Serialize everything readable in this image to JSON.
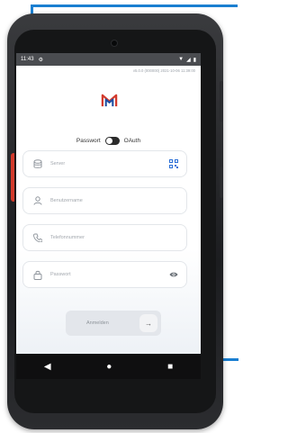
{
  "status_bar": {
    "time": "11:43",
    "signal_icon": "wifi-icon",
    "battery_icon": "battery-icon"
  },
  "version_text": "v5.0.0 (000000) 2021-10-06 11:39:00",
  "auth_toggle": {
    "left_label": "Passwort",
    "right_label": "OAuth"
  },
  "fields": {
    "server": {
      "placeholder": "Server",
      "icon": "database-icon",
      "trailing_icon": "qr-code-icon"
    },
    "username": {
      "placeholder": "Benutzername",
      "icon": "user-icon"
    },
    "phone": {
      "placeholder": "Telefonnummer",
      "icon": "phone-icon"
    },
    "password": {
      "placeholder": "Passwort",
      "icon": "lock-icon",
      "trailing_icon": "eye-icon"
    }
  },
  "login_button": {
    "label": "Anmelden",
    "icon": "arrow-right-icon"
  },
  "colors": {
    "accent": "#1a7fd1",
    "brand_red": "#d33a2c",
    "brand_blue": "#1f4fa3",
    "qr_blue": "#2b6fd6"
  }
}
